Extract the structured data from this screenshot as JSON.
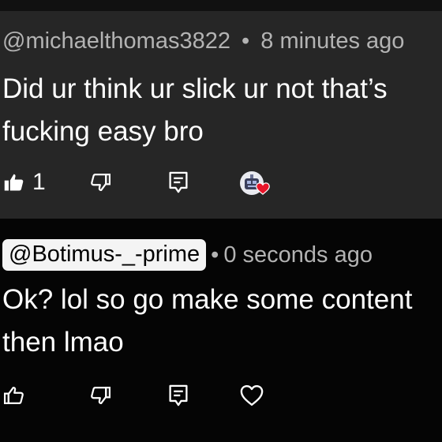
{
  "comments": [
    {
      "handle": "@michaelthomas3822",
      "separator": "•",
      "time": "8 minutes ago",
      "text": "Did ur think ur slick ur not that’s\nfucking easy bro",
      "likes": "1",
      "icons": [
        "thumbs-up-filled-icon",
        "thumbs-down-icon",
        "reply-icon",
        "creator-heart-avatar"
      ]
    },
    {
      "handle": "@Botimus-_-prime",
      "separator": "•",
      "time": "0 seconds ago",
      "text": "Ok? lol so go make some content\nthen lmao",
      "icons": [
        "thumbs-up-icon",
        "thumbs-down-icon",
        "reply-icon",
        "heart-icon"
      ]
    }
  ],
  "colors": {
    "comment1_bg": "#262626",
    "comment2_bg": "#050505",
    "heart": "#e8152a"
  }
}
